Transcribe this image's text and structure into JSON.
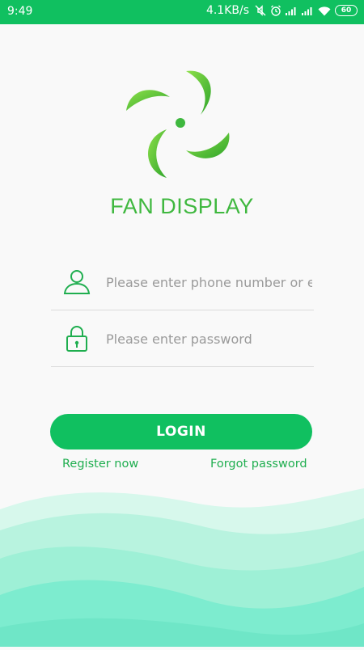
{
  "status_bar": {
    "time": "9:49",
    "network_speed": "4.1KB/s",
    "battery": "60",
    "icons": [
      "mute-icon",
      "alarm-icon",
      "signal-icon",
      "signal-icon",
      "wifi-icon",
      "battery-icon"
    ]
  },
  "app": {
    "title": "FAN DISPLAY",
    "logo_icon": "fan-logo-icon"
  },
  "form": {
    "username": {
      "value": "",
      "placeholder": "Please enter phone number or email",
      "icon": "user-icon"
    },
    "password": {
      "value": "",
      "placeholder": "Please enter password",
      "icon": "lock-icon"
    },
    "login_label": "LOGIN"
  },
  "links": {
    "register": "Register now",
    "forgot": "Forgot password"
  },
  "colors": {
    "primary": "#10c060",
    "title": "#3fb83f",
    "link": "#1fae4f",
    "background": "#f9f9f9",
    "wave": "#7deccf"
  }
}
